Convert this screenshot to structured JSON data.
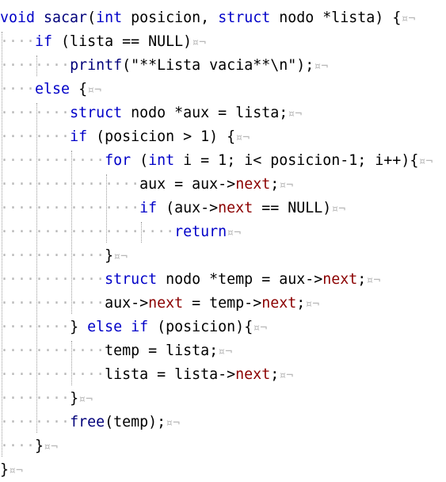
{
  "editor": {
    "colors": {
      "background": "#ffffff",
      "keyword": "#0000c8",
      "function_name": "#00007a",
      "member": "#8b0000",
      "text": "#000000",
      "whitespace_marker": "#b8b8b8"
    },
    "whitespace_symbol": "·",
    "eol_marker": "¤¬",
    "lines": [
      {
        "indent": 0,
        "tokens": [
          {
            "t": "void ",
            "c": "kw"
          },
          {
            "t": "sacar",
            "c": "fn"
          },
          {
            "t": "(",
            "c": "plain"
          },
          {
            "t": "int",
            "c": "kw"
          },
          {
            "t": " posicion, ",
            "c": "plain"
          },
          {
            "t": "struct",
            "c": "kw"
          },
          {
            "t": " nodo *lista) {",
            "c": "plain"
          }
        ]
      },
      {
        "indent": 1,
        "tokens": [
          {
            "t": "if",
            "c": "kw"
          },
          {
            "t": " (lista == NULL)",
            "c": "plain"
          }
        ]
      },
      {
        "indent": 2,
        "tokens": [
          {
            "t": "printf",
            "c": "fn"
          },
          {
            "t": "(\"**Lista vacia**\\n\");",
            "c": "plain"
          }
        ]
      },
      {
        "indent": 1,
        "tokens": [
          {
            "t": "else",
            "c": "kw"
          },
          {
            "t": " {",
            "c": "plain"
          }
        ]
      },
      {
        "indent": 2,
        "tokens": [
          {
            "t": "struct",
            "c": "kw"
          },
          {
            "t": " nodo *aux = lista;",
            "c": "plain"
          }
        ]
      },
      {
        "indent": 2,
        "tokens": [
          {
            "t": "if",
            "c": "kw"
          },
          {
            "t": " (posicion > 1) {",
            "c": "plain"
          }
        ]
      },
      {
        "indent": 3,
        "tokens": [
          {
            "t": "for",
            "c": "kw"
          },
          {
            "t": " (",
            "c": "plain"
          },
          {
            "t": "int",
            "c": "kw"
          },
          {
            "t": " i = 1; i< posicion-1; i++){",
            "c": "plain"
          }
        ]
      },
      {
        "indent": 4,
        "tokens": [
          {
            "t": "aux = aux->",
            "c": "plain"
          },
          {
            "t": "next",
            "c": "mb"
          },
          {
            "t": ";",
            "c": "plain"
          }
        ]
      },
      {
        "indent": 4,
        "tokens": [
          {
            "t": "if",
            "c": "kw"
          },
          {
            "t": " (aux->",
            "c": "plain"
          },
          {
            "t": "next",
            "c": "mb"
          },
          {
            "t": " == NULL)",
            "c": "plain"
          }
        ]
      },
      {
        "indent": 5,
        "tokens": [
          {
            "t": "return",
            "c": "kw"
          }
        ]
      },
      {
        "indent": 3,
        "tokens": [
          {
            "t": "}",
            "c": "plain"
          }
        ]
      },
      {
        "indent": 3,
        "tokens": [
          {
            "t": "struct",
            "c": "kw"
          },
          {
            "t": " nodo *temp = aux->",
            "c": "plain"
          },
          {
            "t": "next",
            "c": "mb"
          },
          {
            "t": ";",
            "c": "plain"
          }
        ]
      },
      {
        "indent": 3,
        "tokens": [
          {
            "t": "aux->",
            "c": "plain"
          },
          {
            "t": "next",
            "c": "mb"
          },
          {
            "t": " = temp->",
            "c": "plain"
          },
          {
            "t": "next",
            "c": "mb"
          },
          {
            "t": ";",
            "c": "plain"
          }
        ]
      },
      {
        "indent": 2,
        "tokens": [
          {
            "t": "} ",
            "c": "plain"
          },
          {
            "t": "else if",
            "c": "kw"
          },
          {
            "t": " (posicion){",
            "c": "plain"
          }
        ]
      },
      {
        "indent": 3,
        "tokens": [
          {
            "t": "temp = lista;",
            "c": "plain"
          }
        ]
      },
      {
        "indent": 3,
        "tokens": [
          {
            "t": "lista = lista->",
            "c": "plain"
          },
          {
            "t": "next",
            "c": "mb"
          },
          {
            "t": ";",
            "c": "plain"
          }
        ]
      },
      {
        "indent": 2,
        "tokens": [
          {
            "t": "}",
            "c": "plain"
          }
        ]
      },
      {
        "indent": 2,
        "tokens": [
          {
            "t": "free",
            "c": "fn"
          },
          {
            "t": "(temp);",
            "c": "plain"
          }
        ]
      },
      {
        "indent": 1,
        "tokens": [
          {
            "t": "}",
            "c": "plain"
          }
        ]
      },
      {
        "indent": 0,
        "tokens": [
          {
            "t": "}",
            "c": "plain"
          }
        ]
      }
    ]
  }
}
